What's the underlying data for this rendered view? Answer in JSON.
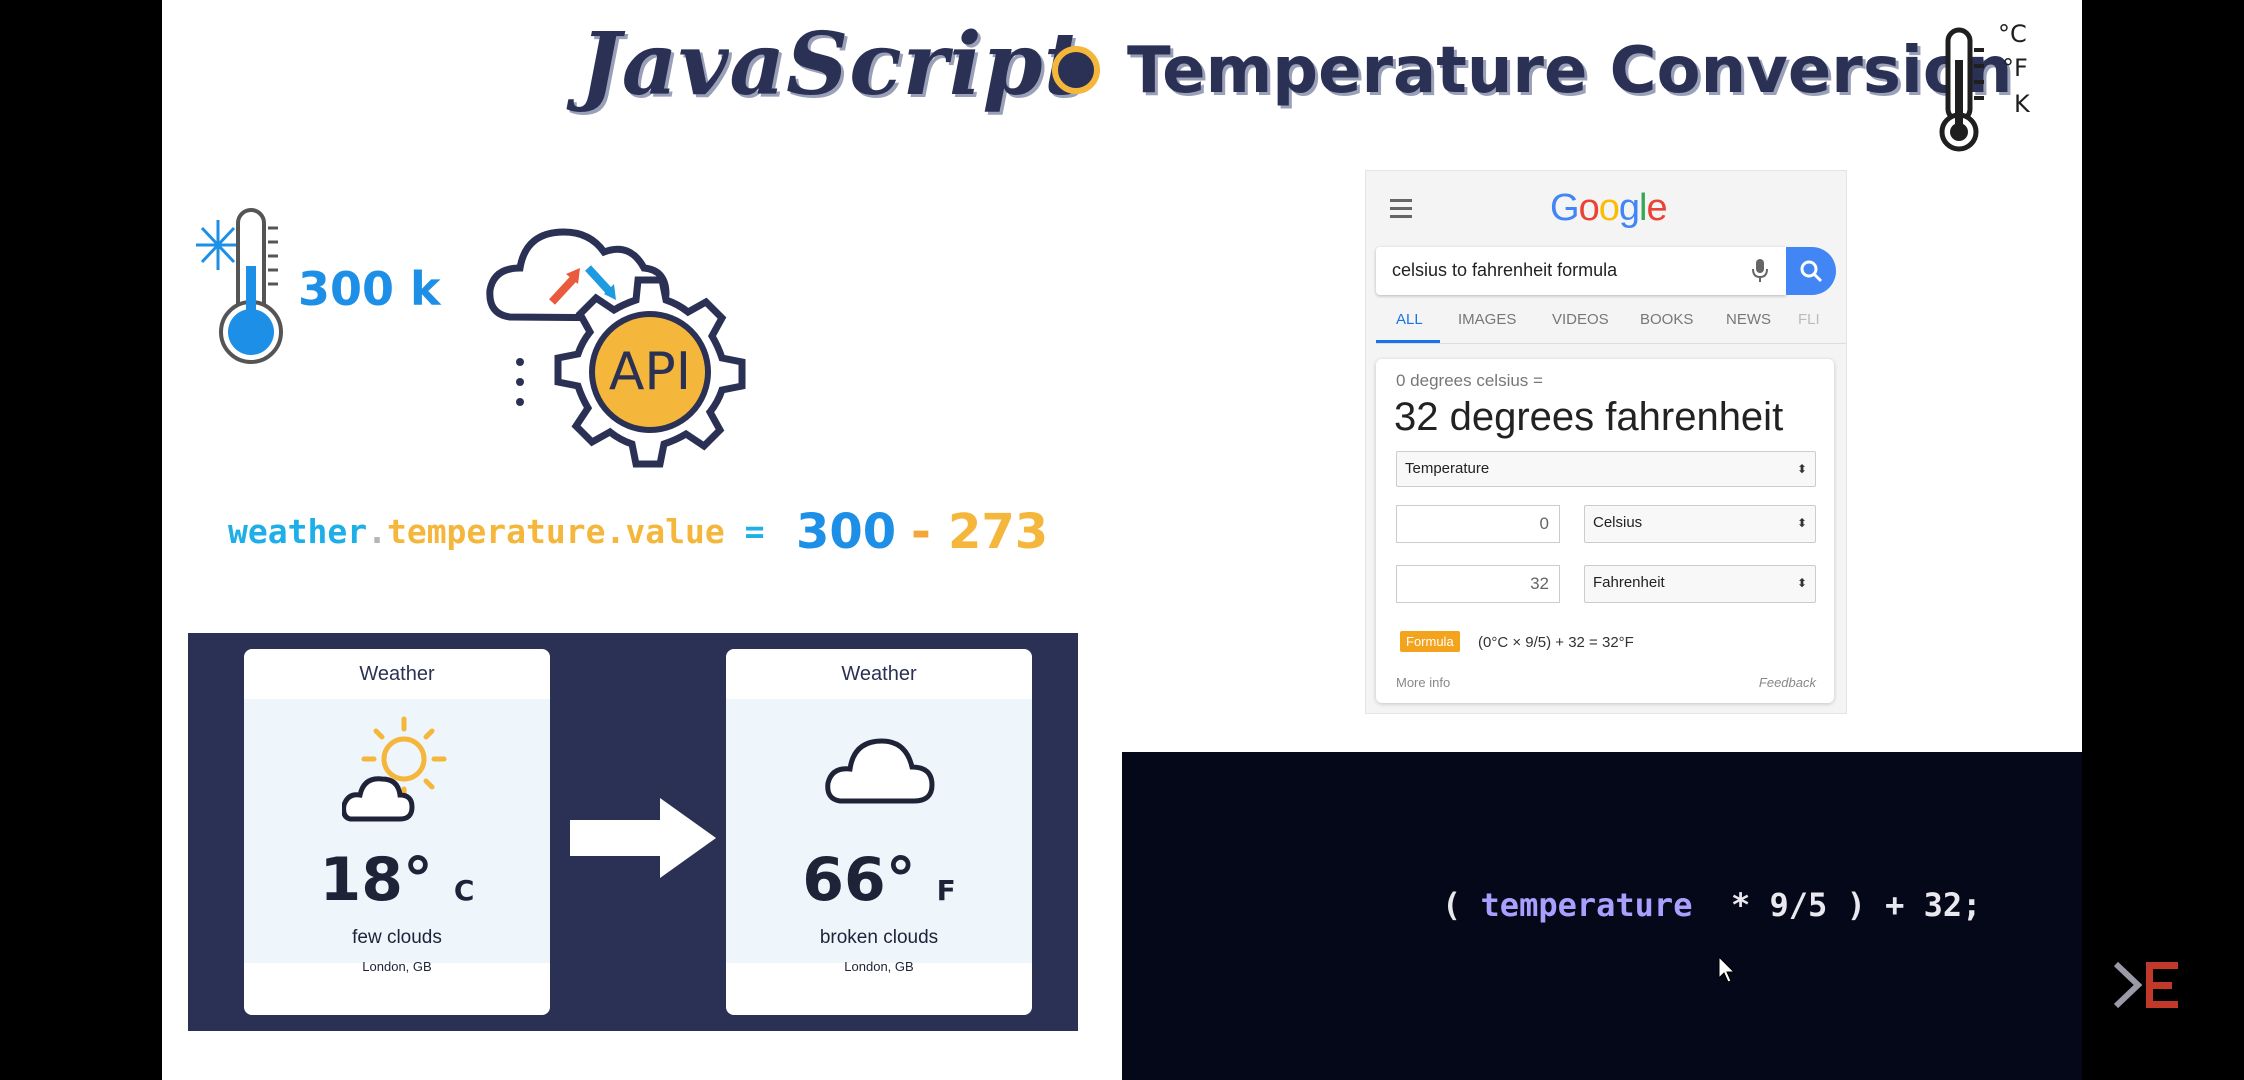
{
  "title": {
    "part1": "JavaScript",
    "part2": "Temperature Conversion",
    "thermometer_labels": [
      "°C",
      "°F",
      "K"
    ]
  },
  "left": {
    "kelvin_label": "300 k",
    "api_label": "API",
    "formula": {
      "object": "weather",
      "dot": ".",
      "path": "temperature.value",
      "equals": "=",
      "value": "300",
      "minus": "-",
      "offset": "273"
    }
  },
  "weather_cards": [
    {
      "header": "Weather",
      "temp": "18°",
      "unit": "C",
      "desc": "few clouds",
      "location": "London, GB",
      "icon": "sun-cloud-icon"
    },
    {
      "header": "Weather",
      "temp": "66°",
      "unit": "F",
      "desc": "broken clouds",
      "location": "London, GB",
      "icon": "cloud-icon"
    }
  ],
  "google": {
    "logo": "Google",
    "logo_colors": [
      "#4285f4",
      "#ea4335",
      "#fbbc05",
      "#4285f4",
      "#34a853",
      "#ea4335"
    ],
    "query": "celsius to fahrenheit formula",
    "tabs": [
      "ALL",
      "IMAGES",
      "VIDEOS",
      "BOOKS",
      "NEWS",
      "FLI"
    ],
    "active_tab": "ALL",
    "result_sub": "0 degrees celsius =",
    "result_main": "32 degrees fahrenheit",
    "unit_type": "Temperature",
    "from_value": "0",
    "from_unit": "Celsius",
    "to_value": "32",
    "to_unit": "Fahrenheit",
    "formula_badge": "Formula",
    "formula_text": "(0°C × 9/5) + 32 = 32°F",
    "more_info": "More info",
    "feedback": "Feedback"
  },
  "code": {
    "open": "( ",
    "variable": "temperature",
    "rest": "  * 9/5 ) + 32;"
  }
}
